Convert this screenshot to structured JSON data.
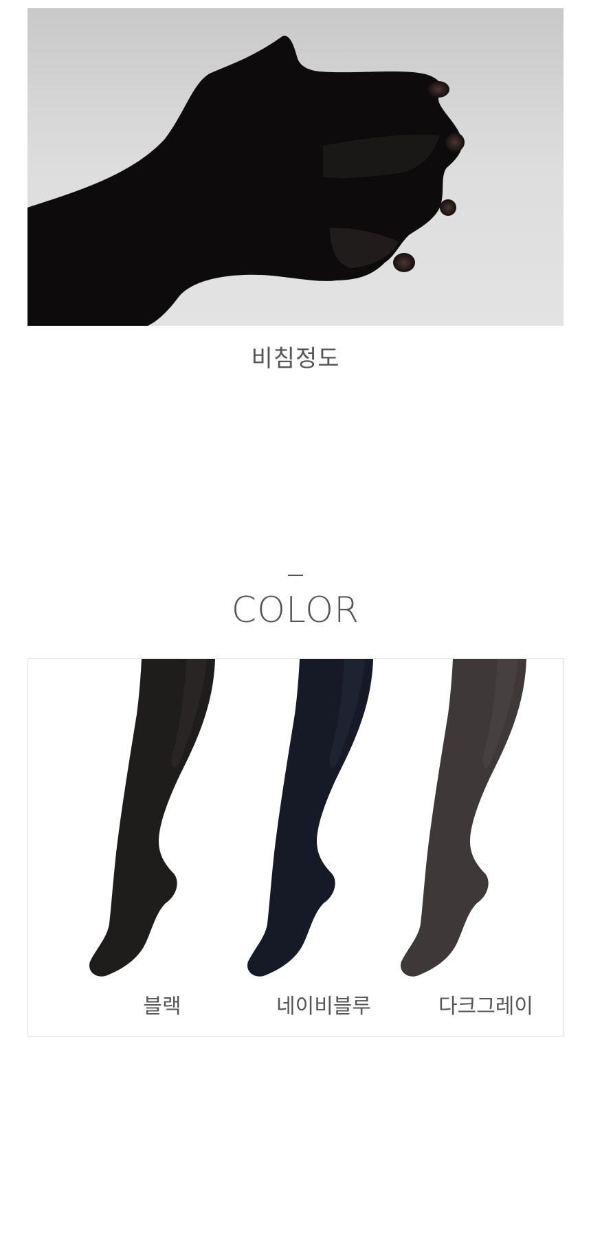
{
  "sheerness": {
    "photo_icon": "hand-in-tights-photo",
    "caption": "비침정도"
  },
  "color_section": {
    "title": "COLOR",
    "options": [
      {
        "label": "블랙",
        "color": "#1f1c1c"
      },
      {
        "label": "네이비블루",
        "color": "#151a26"
      },
      {
        "label": "다크그레이",
        "color": "#3e3838"
      }
    ]
  },
  "colors": {
    "text": "#555555",
    "border": "#dcdcdc",
    "hero_background": "#dcdcdc"
  }
}
